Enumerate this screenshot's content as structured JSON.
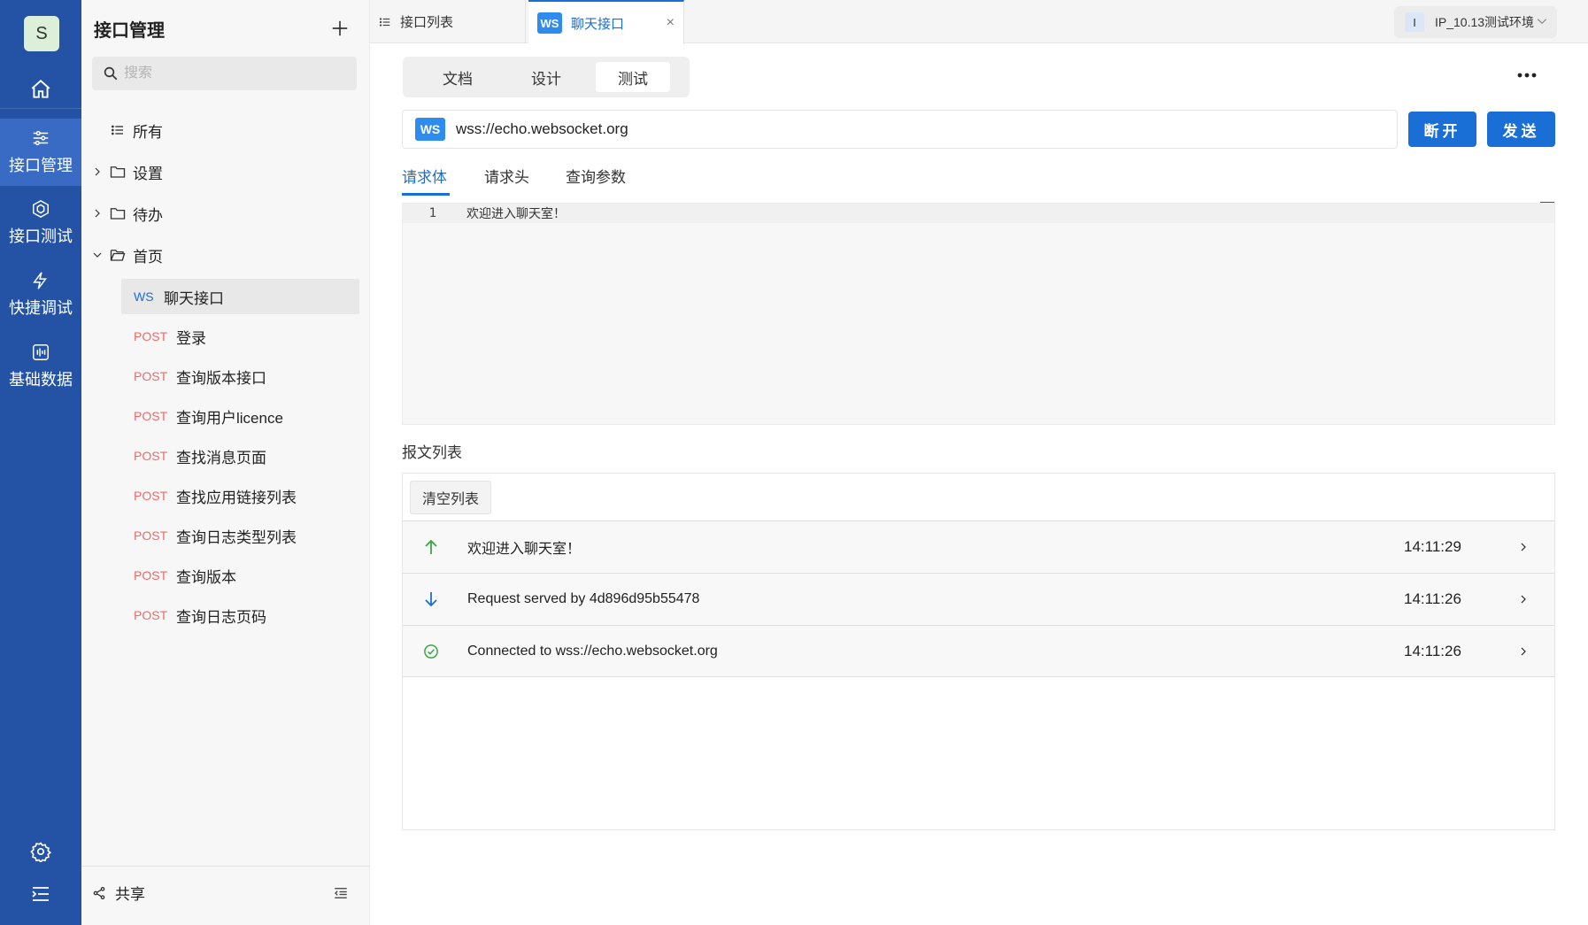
{
  "rail": {
    "avatar_letter": "S",
    "nav": [
      {
        "label": "接口管理",
        "icon": "sliders-icon"
      },
      {
        "label": "接口测试",
        "icon": "cube-icon"
      },
      {
        "label": "快捷调试",
        "icon": "lightning-icon"
      },
      {
        "label": "基础数据",
        "icon": "database-icon"
      }
    ],
    "accent": "#2453a6"
  },
  "panel": {
    "title": "接口管理",
    "search_placeholder": "搜索",
    "tree": {
      "all": "所有",
      "folders": [
        "设置",
        "待办",
        "首页"
      ]
    },
    "apis": [
      {
        "method": "WS",
        "name": "聊天接口"
      },
      {
        "method": "POST",
        "name": "登录"
      },
      {
        "method": "POST",
        "name": "查询版本接口"
      },
      {
        "method": "POST",
        "name": "查询用户licence"
      },
      {
        "method": "POST",
        "name": "查找消息页面"
      },
      {
        "method": "POST",
        "name": "查找应用链接列表"
      },
      {
        "method": "POST",
        "name": "查询日志类型列表"
      },
      {
        "method": "POST",
        "name": "查询版本"
      },
      {
        "method": "POST",
        "name": "查询日志页码"
      }
    ],
    "share_label": "共享"
  },
  "tabs": {
    "list_tab": "接口列表",
    "active_badge": "WS",
    "active_tab": "聊天接口",
    "close": "×"
  },
  "env": {
    "box": "I",
    "name": "IP_10.13测试环境"
  },
  "mode": [
    "文档",
    "设计",
    "测试"
  ],
  "request": {
    "badge": "WS",
    "url": "wss://echo.websocket.org",
    "disconnect": "断开",
    "send": "发送"
  },
  "subtabs": [
    "请求体",
    "请求头",
    "查询参数"
  ],
  "editor": {
    "line_no": "1",
    "code": "欢迎进入聊天室！"
  },
  "messages": {
    "title": "报文列表",
    "clear": "清空列表",
    "rows": [
      {
        "dir": "sent",
        "text": "欢迎进入聊天室！",
        "time": "14:11:29"
      },
      {
        "dir": "received",
        "text": "Request served by 4d896d95b55478",
        "time": "14:11:26"
      },
      {
        "dir": "connected",
        "text": "Connected to wss://echo.websocket.org",
        "time": "14:11:26"
      }
    ]
  },
  "colors": {
    "primary": "#1a6fd6",
    "post": "#ee6a6a",
    "success": "#3aa845"
  }
}
